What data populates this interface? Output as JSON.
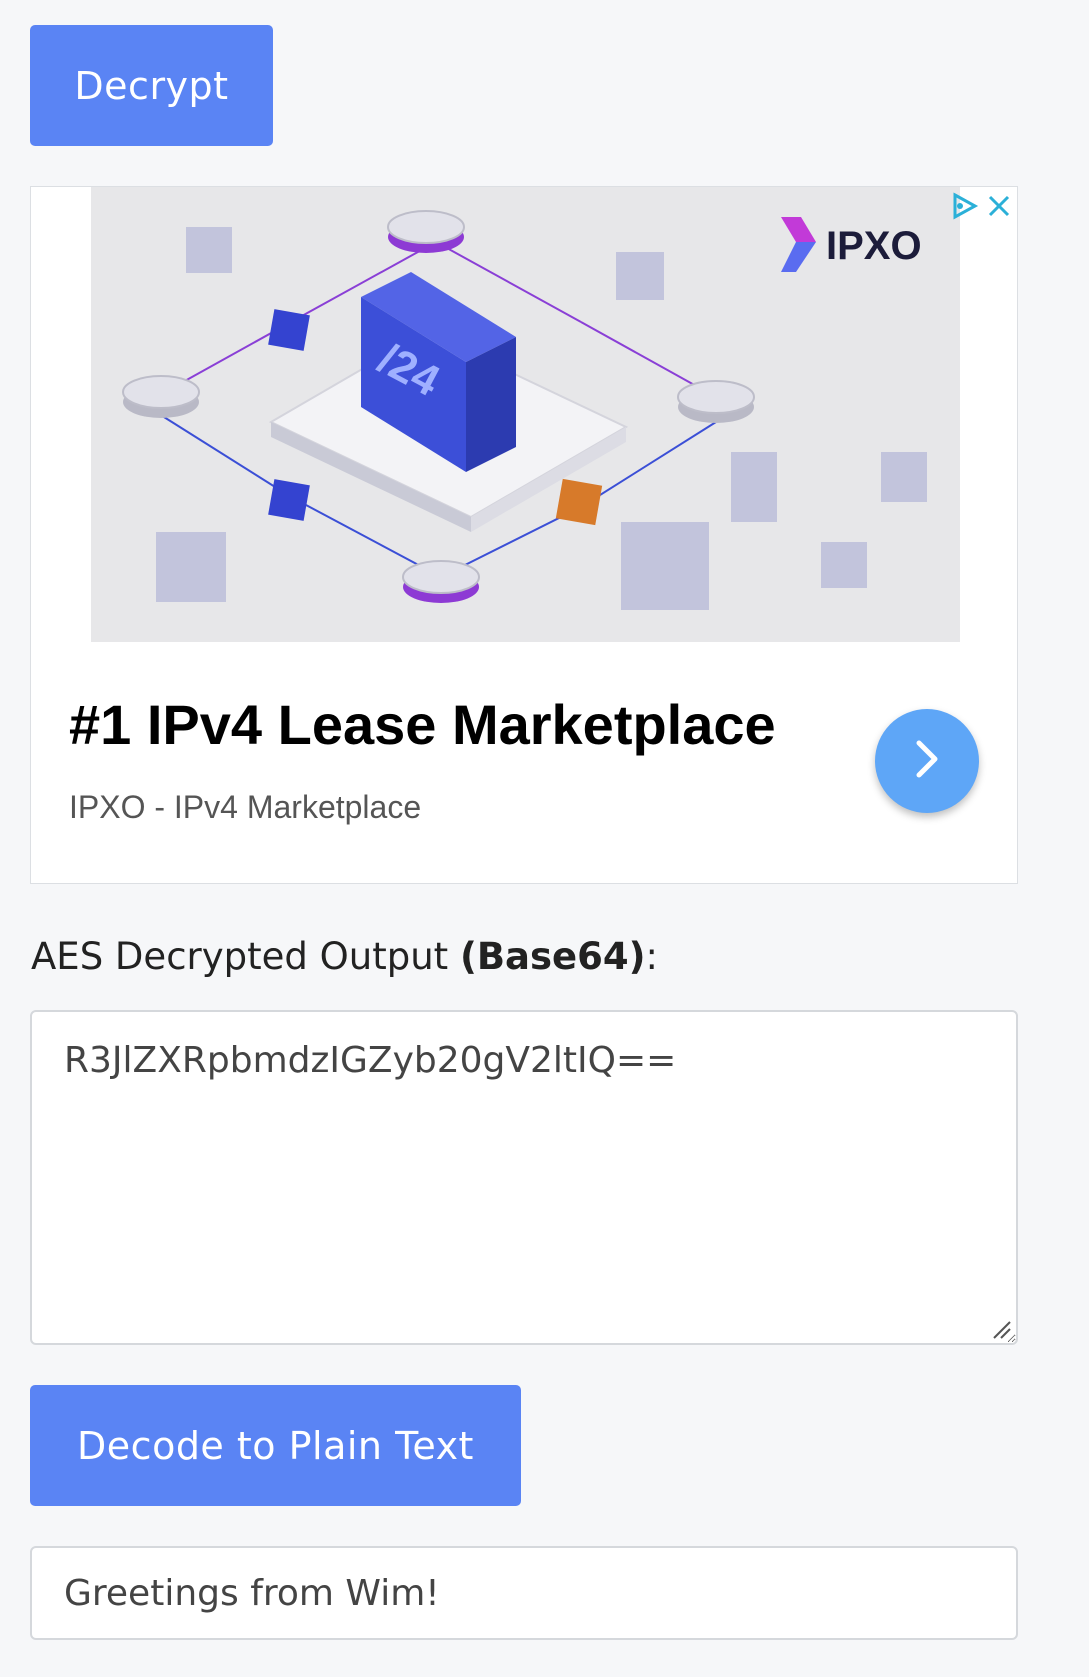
{
  "decrypt_button": {
    "label": "Decrypt"
  },
  "ad": {
    "brand": "IPXO",
    "image_badge": "/24",
    "title": "#1 IPv4 Lease Marketplace",
    "subtitle": "IPXO - IPv4 Marketplace",
    "adchoices_icon": "adchoices-icon",
    "close_icon": "close-icon",
    "arrow_icon": "chevron-right-icon",
    "arrow_color": "#5ea6f7"
  },
  "output": {
    "label_prefix": "AES Decrypted Output ",
    "label_bold": "(Base64)",
    "label_suffix": ":",
    "value": "R3JlZXRpbmdzIGZyb20gV2ltIQ=="
  },
  "decode_button": {
    "label": "Decode to Plain Text"
  },
  "plain_text": {
    "value": "Greetings from Wim!"
  },
  "colors": {
    "button": "#5a84f4",
    "background": "#f6f7f9"
  }
}
